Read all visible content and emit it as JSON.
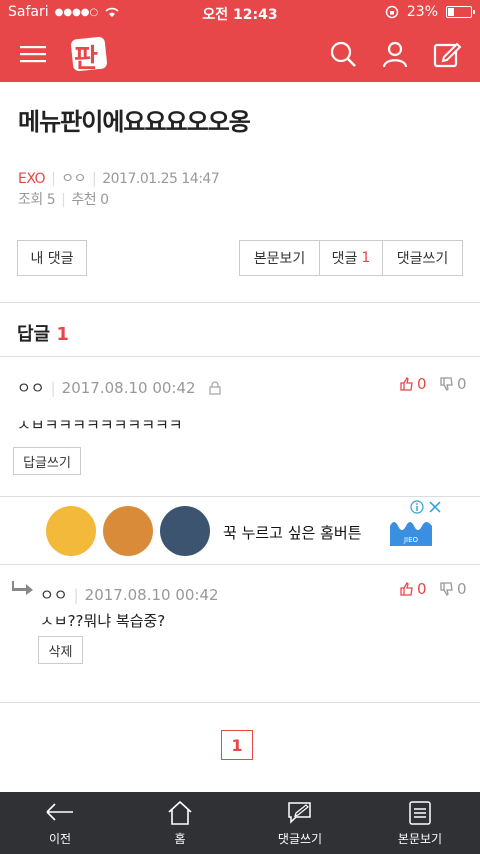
{
  "status_bar": {
    "carrier": "Safari",
    "signal": "●●●●○",
    "time": "오전 12:43",
    "battery": "23%"
  },
  "nav": {
    "logo_char": "판",
    "menu_icon": "hamburger-icon",
    "search_icon": "search-icon",
    "profile_icon": "user-icon",
    "write_icon": "edit-icon"
  },
  "post": {
    "title": "메뉴판이에요요요오오옹",
    "category": "EXO",
    "author": "ㅇㅇ",
    "date": "2017.01.25 14:47",
    "views_label": "조회",
    "views": "5",
    "recommend_label": "추천",
    "recommend": "0"
  },
  "buttons": {
    "my_comments": "내 댓글",
    "view_post": "본문보기",
    "comments": "댓글",
    "comments_count": "1",
    "write_comment": "댓글쓰기"
  },
  "replies": {
    "header": "답글",
    "count": "1"
  },
  "comments": [
    {
      "author": "ㅇㅇ",
      "date": "2017.08.10 00:42",
      "text": "ㅅㅂㅋㅋㅋㅋㅋㅋㅋㅋㅋㅋ",
      "up": "0",
      "down": "0",
      "action": "답글쓰기"
    },
    {
      "author": "ㅇㅇ",
      "date": "2017.08.10 00:42",
      "text": "ㅅㅂ??뭐냐 복습중?",
      "up": "0",
      "down": "0",
      "action": "삭제"
    }
  ],
  "ad": {
    "text": "꾹 누르고 싶은 홈버튼",
    "brand": "JIEO"
  },
  "pagination": {
    "current": "1"
  },
  "tab_bar": [
    {
      "label": "이전",
      "icon": "back-arrow-icon"
    },
    {
      "label": "홈",
      "icon": "home-icon"
    },
    {
      "label": "댓글쓰기",
      "icon": "comment-write-icon"
    },
    {
      "label": "본문보기",
      "icon": "document-icon"
    }
  ],
  "colors": {
    "accent": "#e8474a",
    "tab_bar": "#2f3135"
  }
}
